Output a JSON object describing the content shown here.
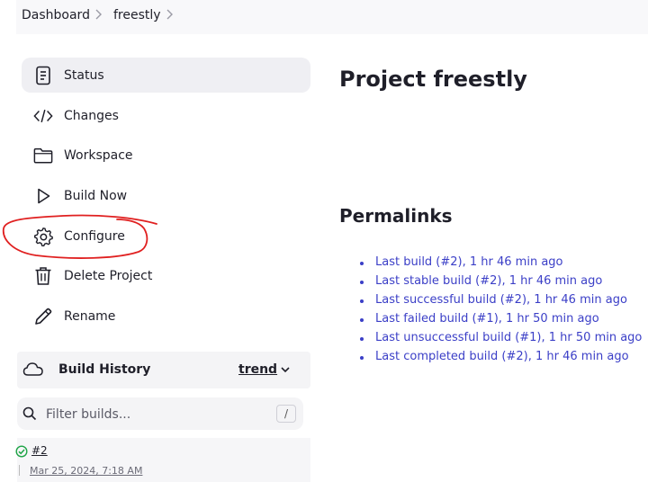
{
  "breadcrumb": [
    "Dashboard",
    "freestly"
  ],
  "sidebar": {
    "items": [
      {
        "label": "Status",
        "icon": "document-icon",
        "active": true
      },
      {
        "label": "Changes",
        "icon": "code-icon"
      },
      {
        "label": "Workspace",
        "icon": "folder-icon"
      },
      {
        "label": "Build Now",
        "icon": "play-icon"
      },
      {
        "label": "Configure",
        "icon": "gear-icon"
      },
      {
        "label": "Delete Project",
        "icon": "trash-icon"
      },
      {
        "label": "Rename",
        "icon": "pencil-icon"
      }
    ]
  },
  "build_history": {
    "title": "Build History",
    "trend_label": "trend",
    "filter_placeholder": "Filter builds...",
    "filter_shortcut": "/",
    "builds": [
      {
        "number": "#2",
        "date": "Mar 25, 2024, 7:18 AM",
        "status": "success"
      }
    ]
  },
  "main": {
    "title": "Project freestly",
    "permalinks_title": "Permalinks",
    "permalinks": [
      "Last build (#2), 1 hr 46 min ago",
      "Last stable build (#2), 1 hr 46 min ago",
      "Last successful build (#2), 1 hr 46 min ago",
      "Last failed build (#1), 1 hr 50 min ago",
      "Last unsuccessful build (#1), 1 hr 50 min ago",
      "Last completed build (#2), 1 hr 46 min ago"
    ]
  },
  "colors": {
    "link": "#3b3fc7",
    "annotation": "#e02020",
    "success": "#1ea446"
  }
}
